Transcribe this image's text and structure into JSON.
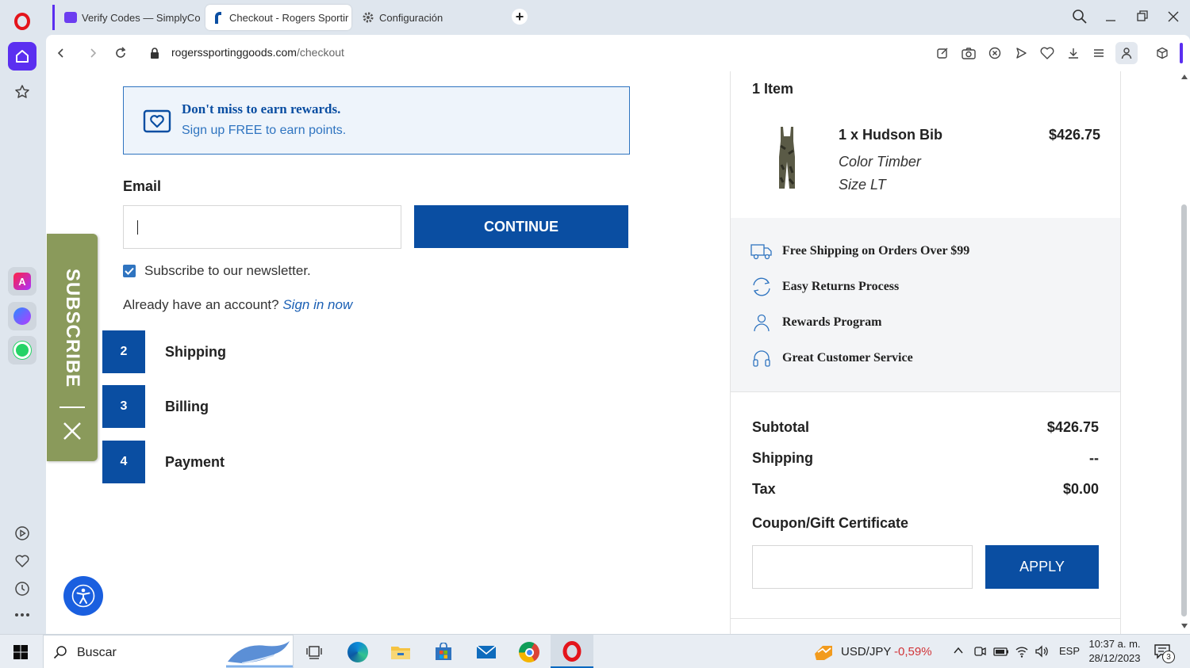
{
  "browser": {
    "tabs": [
      {
        "label": "Verify Codes — SimplyCo"
      },
      {
        "label": "Checkout - Rogers Sportir"
      },
      {
        "label": "Configuración"
      }
    ],
    "url_domain": "rogerssportinggoods.com",
    "url_path": "/checkout"
  },
  "checkout": {
    "rewards_title": "Don't miss to earn rewards.",
    "rewards_sub": "Sign up FREE to earn points.",
    "email_label": "Email",
    "email_value": "",
    "continue_label": "CONTINUE",
    "newsletter_label": "Subscribe to our newsletter.",
    "newsletter_checked": true,
    "account_prompt": "Already have an account?",
    "sign_in_label": "Sign in now",
    "steps": [
      {
        "num": "2",
        "label": "Shipping"
      },
      {
        "num": "3",
        "label": "Billing"
      },
      {
        "num": "4",
        "label": "Payment"
      }
    ],
    "subscribe_tab": "SUBSCRIBE"
  },
  "order": {
    "item_count": "1 Item",
    "item_name": "1 x Hudson Bib",
    "item_price": "$426.75",
    "item_color": "Color Timber",
    "item_size": "Size LT",
    "perks": [
      {
        "label": "Free Shipping on Orders Over $99",
        "icon": "truck-icon"
      },
      {
        "label": "Easy Returns Process",
        "icon": "returns-icon"
      },
      {
        "label": "Rewards Program",
        "icon": "user-icon"
      },
      {
        "label": "Great Customer Service",
        "icon": "headset-icon"
      }
    ],
    "subtotal_label": "Subtotal",
    "subtotal_value": "$426.75",
    "shipping_label": "Shipping",
    "shipping_value": "--",
    "tax_label": "Tax",
    "tax_value": "$0.00",
    "coupon_label": "Coupon/Gift Certificate",
    "coupon_value": "",
    "apply_label": "APPLY"
  },
  "taskbar": {
    "search_placeholder": "Buscar",
    "ticker_label": "USD/JPY",
    "ticker_change": "-0,59%",
    "language": "ESP",
    "time": "10:37 a. m.",
    "date": "28/12/2023",
    "notification_count": "3"
  },
  "colors": {
    "brand_blue": "#0a4ea2",
    "subscribe_green": "#8a9a5b",
    "opera_red": "#e4141b",
    "ticker_red": "#d13438"
  }
}
